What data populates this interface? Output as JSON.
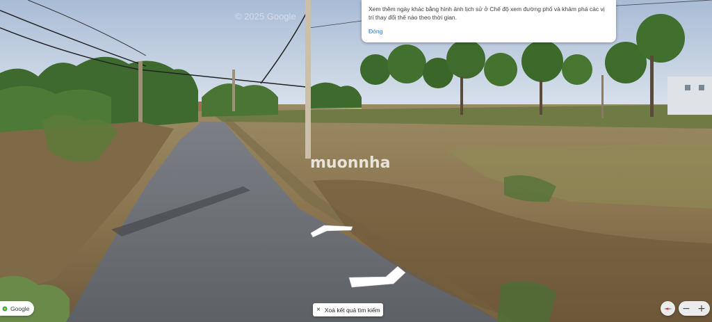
{
  "tooltip": {
    "text": "Xem thêm ngày khác bằng hình ảnh lịch sử ở Chế độ xem đường phố và khám phá các vị trí thay đổi thế nào theo thời gian.",
    "close_label": "Đóng"
  },
  "imagery_copyright": "© 2025 Google",
  "watermark": "muonnha",
  "search_chip": {
    "close_icon": "×",
    "label": "Xoá kết quả tìm kiếm"
  },
  "footer": {
    "google_label": "Google"
  },
  "controls": {
    "compass_icon": "compass-icon",
    "zoom_out": "−",
    "zoom_in": "+"
  },
  "navigation_arrows": [
    "forward-arrow",
    "back-arrow"
  ]
}
